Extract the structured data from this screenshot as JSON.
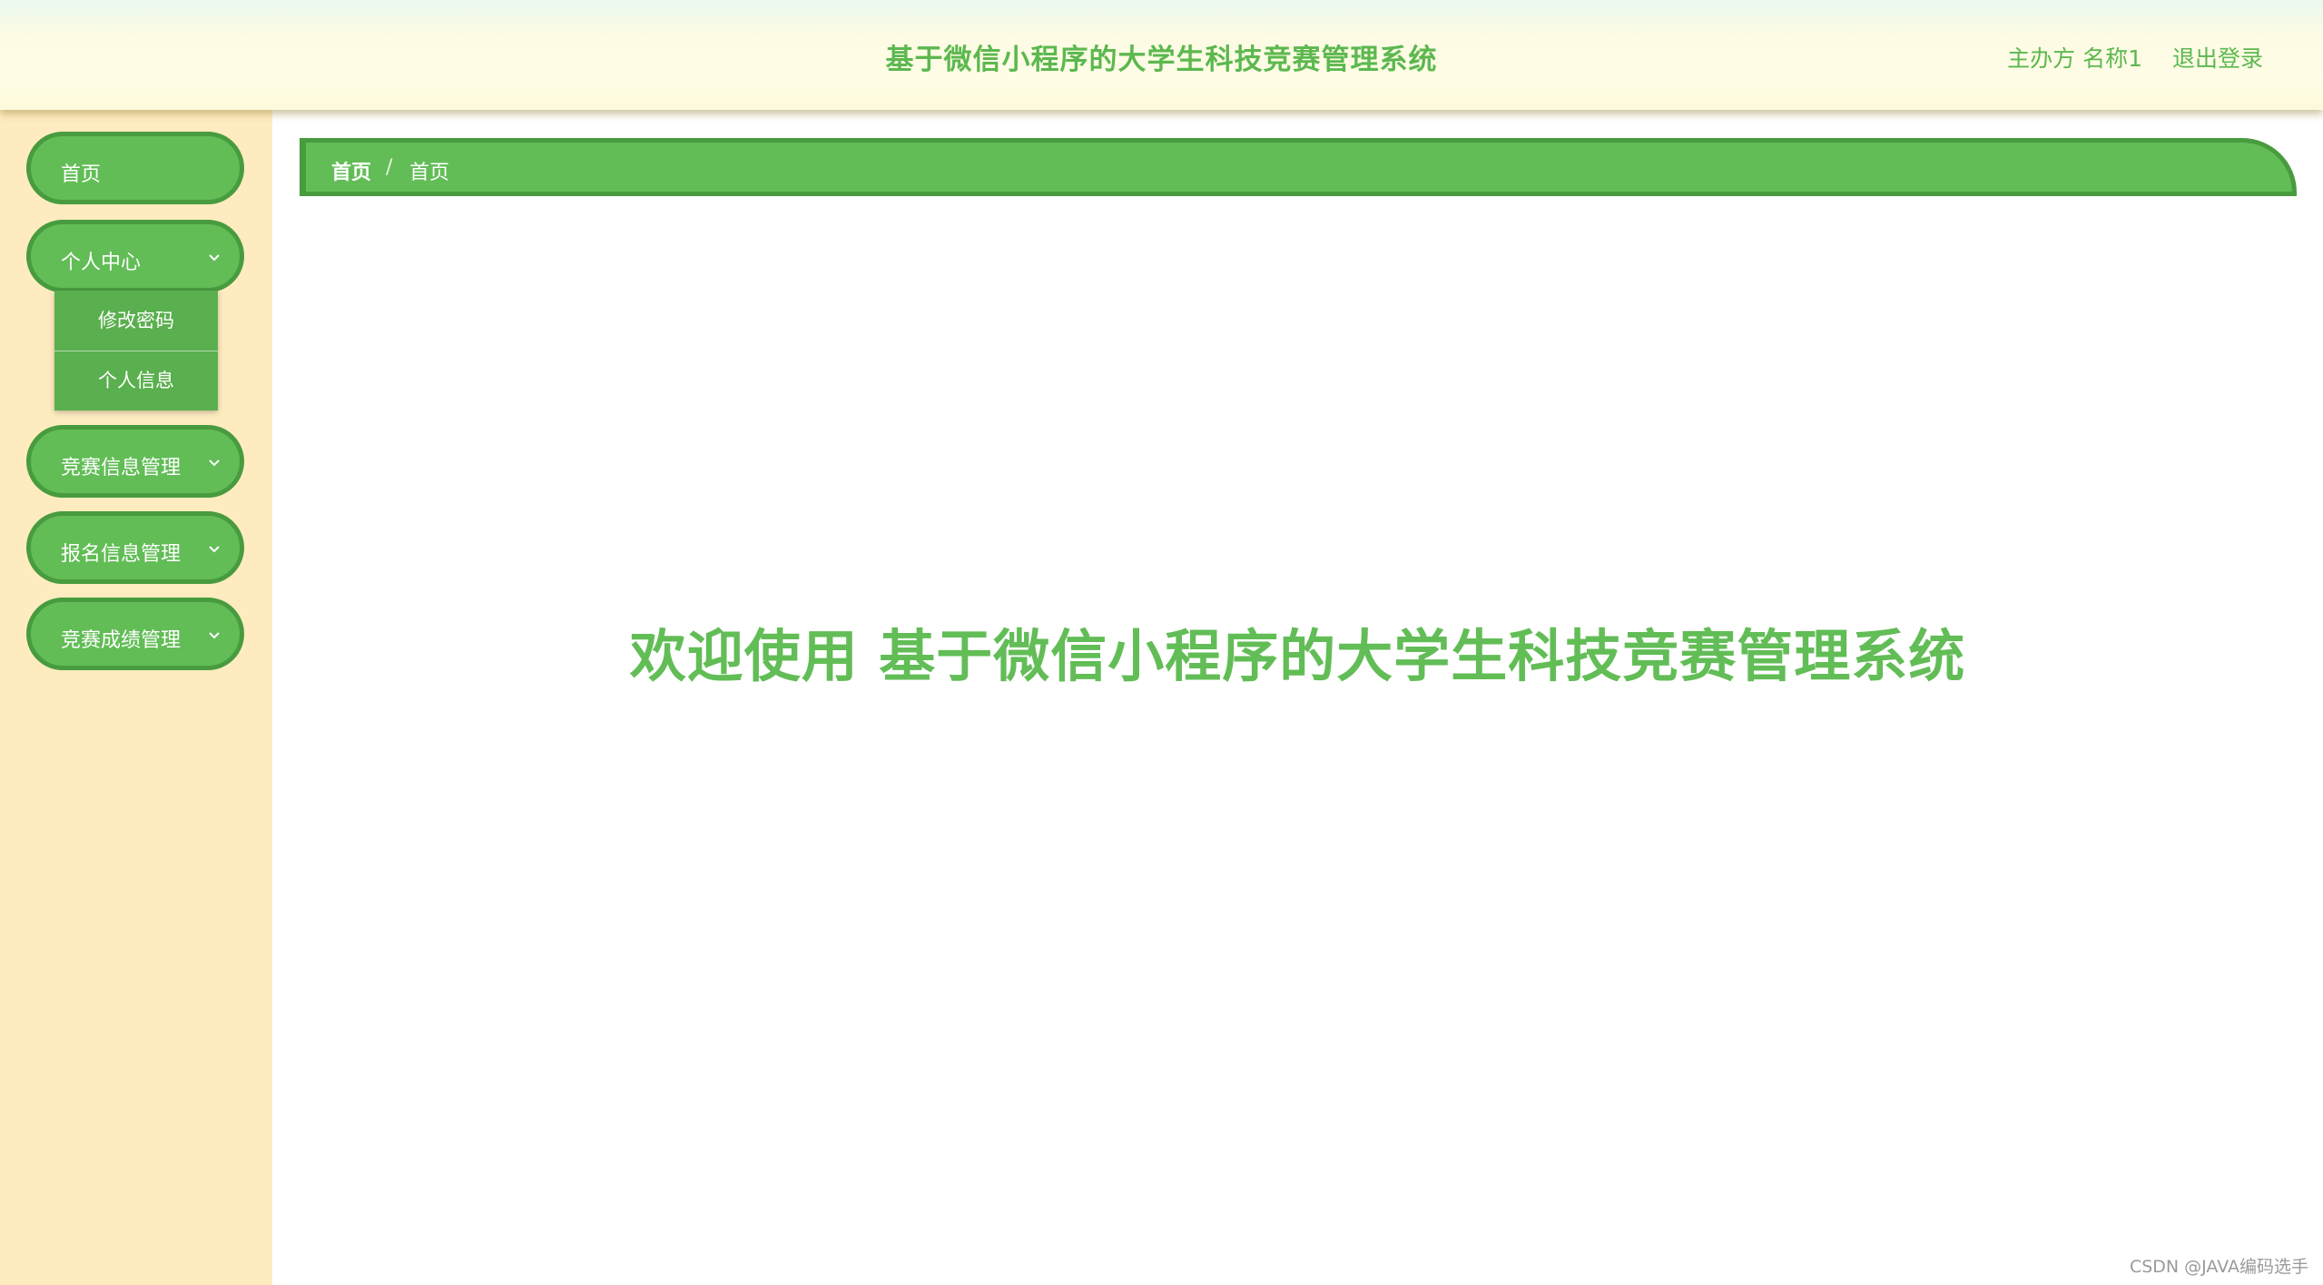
{
  "header": {
    "title": "基于微信小程序的大学生科技竞赛管理系统",
    "user_label": "主办方 名称1",
    "logout_label": "退出登录"
  },
  "sidebar": {
    "items": [
      {
        "label": "首页",
        "icon": ""
      },
      {
        "label": "个人中心",
        "icon": "chevron-down-icon",
        "expanded": true,
        "children": [
          {
            "label": "修改密码"
          },
          {
            "label": "个人信息"
          }
        ]
      },
      {
        "label": "竞赛信息管理",
        "icon": "chevron-down-icon"
      },
      {
        "label": "报名信息管理",
        "icon": "chevron-down-icon"
      },
      {
        "label": "竞赛成绩管理",
        "icon": "chevron-down-icon"
      }
    ]
  },
  "breadcrumb": {
    "home": "首页",
    "separator": "/",
    "current": "首页"
  },
  "main": {
    "welcome": "欢迎使用 基于微信小程序的大学生科技竞赛管理系统"
  },
  "watermark": "CSDN @JAVA编码选手",
  "colors": {
    "accent_green": "#62bd56",
    "border_green": "#489b3e",
    "sidebar_bg": "#feecc0",
    "header_bg": "#fffde6"
  }
}
